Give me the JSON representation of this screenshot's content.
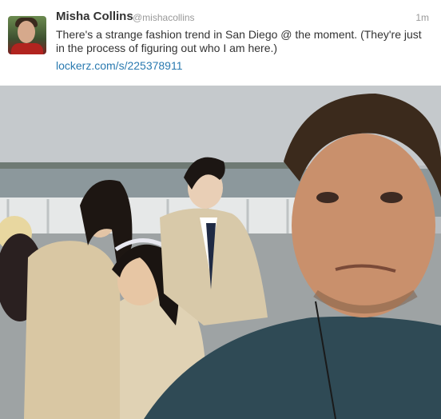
{
  "tweet": {
    "author_name": "Misha Collins",
    "author_handle": "@mishacollins",
    "timestamp": "1m",
    "text": "There's a strange fashion trend in San Diego @ the moment. (They're just in the process of figuring out who I am here.)",
    "link_text": "lockerz.com/s/225378911"
  },
  "colors": {
    "link": "#2a7ab0",
    "name": "#333333",
    "meta": "#999999"
  },
  "icons": {
    "avatar": "author-avatar",
    "photo": "attached-photo"
  }
}
